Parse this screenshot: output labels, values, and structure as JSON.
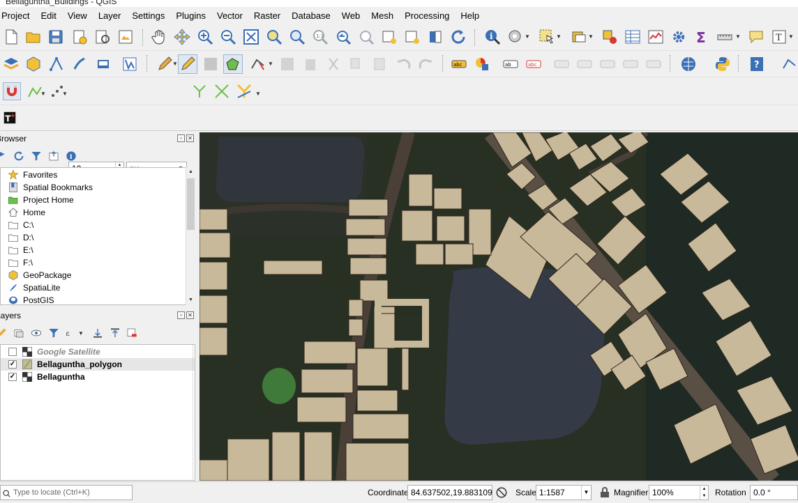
{
  "window": {
    "title": "Bellaguntha_Buildings - QGIS"
  },
  "menu": [
    "Project",
    "Edit",
    "View",
    "Layer",
    "Settings",
    "Plugins",
    "Vector",
    "Raster",
    "Database",
    "Web",
    "Mesh",
    "Processing",
    "Help"
  ],
  "snapping": {
    "tolerance": "12",
    "unit": "px"
  },
  "browser": {
    "title": "Browser",
    "items": [
      {
        "label": "Favorites",
        "icon": "star-icon"
      },
      {
        "label": "Spatial Bookmarks",
        "icon": "bookmark-icon"
      },
      {
        "label": "Project Home",
        "icon": "project-home-icon"
      },
      {
        "label": "Home",
        "icon": "home-icon"
      },
      {
        "label": "C:\\",
        "icon": "folder-icon"
      },
      {
        "label": "D:\\",
        "icon": "folder-icon"
      },
      {
        "label": "E:\\",
        "icon": "folder-icon"
      },
      {
        "label": "F:\\",
        "icon": "folder-icon"
      },
      {
        "label": "GeoPackage",
        "icon": "geopackage-icon"
      },
      {
        "label": "SpatiaLite",
        "icon": "spatialite-icon"
      },
      {
        "label": "PostGIS",
        "icon": "postgis-icon"
      }
    ]
  },
  "layers": {
    "title": "Layers",
    "items": [
      {
        "label": "Google Satellite",
        "checked": false,
        "icon": "raster-layer-icon"
      },
      {
        "label": "Bellaguntha_polygon",
        "checked": true,
        "icon": "polygon-layer-icon"
      },
      {
        "label": "Bellaguntha",
        "checked": true,
        "icon": "raster-layer-icon"
      }
    ]
  },
  "statusbar": {
    "locate_placeholder": "Type to locate (Ctrl+K)",
    "coordinate_label": "Coordinate",
    "coordinate_value": "84.637502,19.883109",
    "scale_label": "Scale",
    "scale_value": "1:1587",
    "magnifier_label": "Magnifier",
    "magnifier_value": "100%",
    "rotation_label": "Rotation",
    "rotation_value": "0.0 °"
  },
  "colors": {
    "building_fill": "#c9b99b",
    "building_stroke": "#2b2418",
    "road": "#5a4f45",
    "pond": "#343a46"
  }
}
